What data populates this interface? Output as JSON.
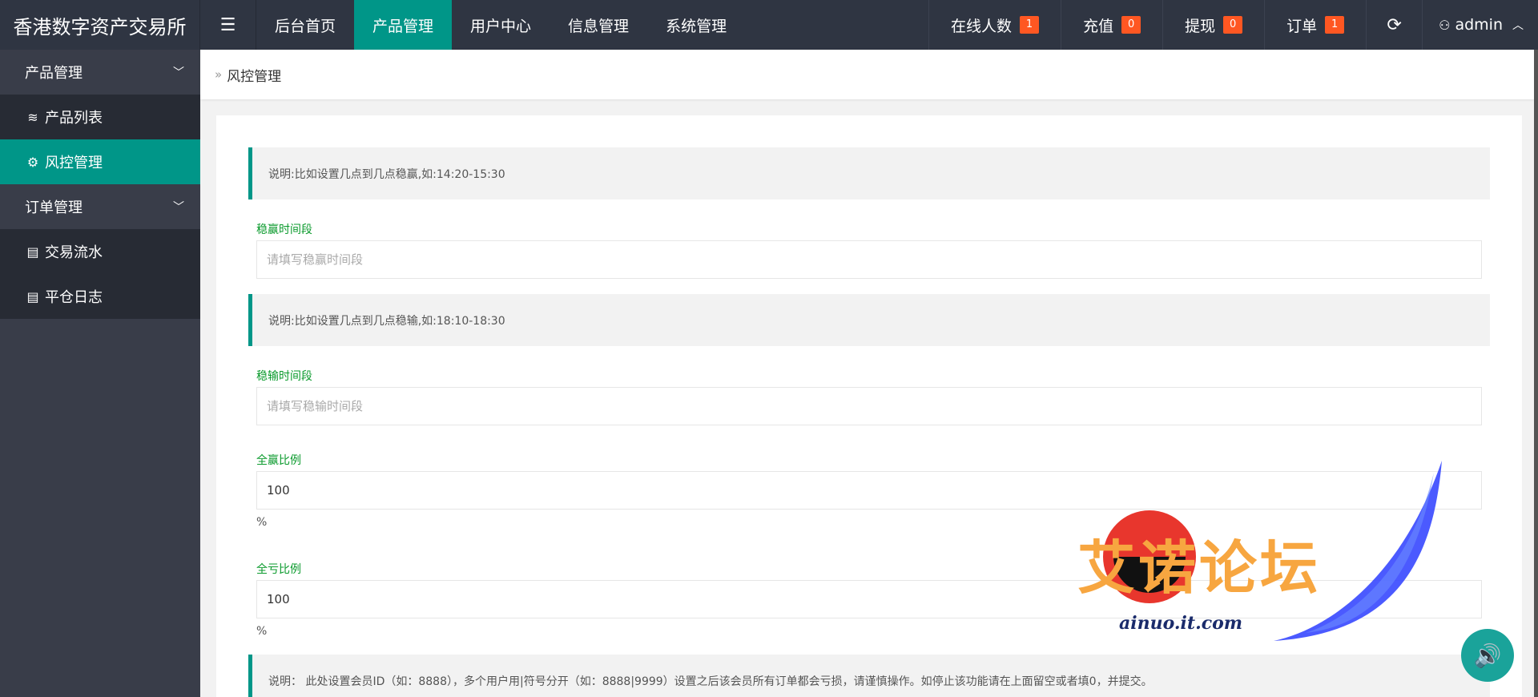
{
  "header": {
    "logo": "香港数字资产交易所",
    "menu_icon": "menu-icon",
    "nav": [
      {
        "label": "后台首页"
      },
      {
        "label": "产品管理"
      },
      {
        "label": "用户中心"
      },
      {
        "label": "信息管理"
      },
      {
        "label": "系统管理"
      }
    ],
    "active_nav": "产品管理",
    "stats": [
      {
        "label": "在线人数",
        "count": "1"
      },
      {
        "label": "充值",
        "count": "0"
      },
      {
        "label": "提现",
        "count": "0"
      },
      {
        "label": "订单",
        "count": "1"
      }
    ],
    "user": "admin"
  },
  "sidebar": {
    "group1": "产品管理",
    "items1": [
      {
        "label": "产品列表"
      },
      {
        "label": "风控管理"
      }
    ],
    "group2": "订单管理",
    "items2": [
      {
        "label": "交易流水"
      },
      {
        "label": "平仓日志"
      }
    ]
  },
  "breadcrumb": {
    "current": "风控管理"
  },
  "form": {
    "note1": "说明:比如设置几点到几点稳赢,如:14:20-15:30",
    "win_label": "稳赢时间段",
    "win_placeholder": "请填写稳赢时间段",
    "note2": "说明:比如设置几点到几点稳输,如:18:10-18:30",
    "lose_label": "稳输时间段",
    "lose_placeholder": "请填写稳输时间段",
    "allwin_label": "全赢比例",
    "allwin_value": "100",
    "allwin_unit": "%",
    "allloss_label": "全亏比例",
    "allloss_value": "100",
    "allloss_unit": "%",
    "note3": "说明： 此处设置会员ID（如：8888），多个用户用|符号分开（如：8888|9999）设置之后该会员所有订单都会亏损，请谨慎操作。如停止该功能请在上面留空或者填0，并提交。"
  },
  "watermark": {
    "title": "艾诺论坛",
    "site": "ainuo.it.com"
  },
  "colors": {
    "accent": "#009688",
    "header_bg": "#2f3542",
    "sidebar_bg": "#393d49",
    "badge": "#ff5722",
    "label_green": "#0a9a2c"
  }
}
